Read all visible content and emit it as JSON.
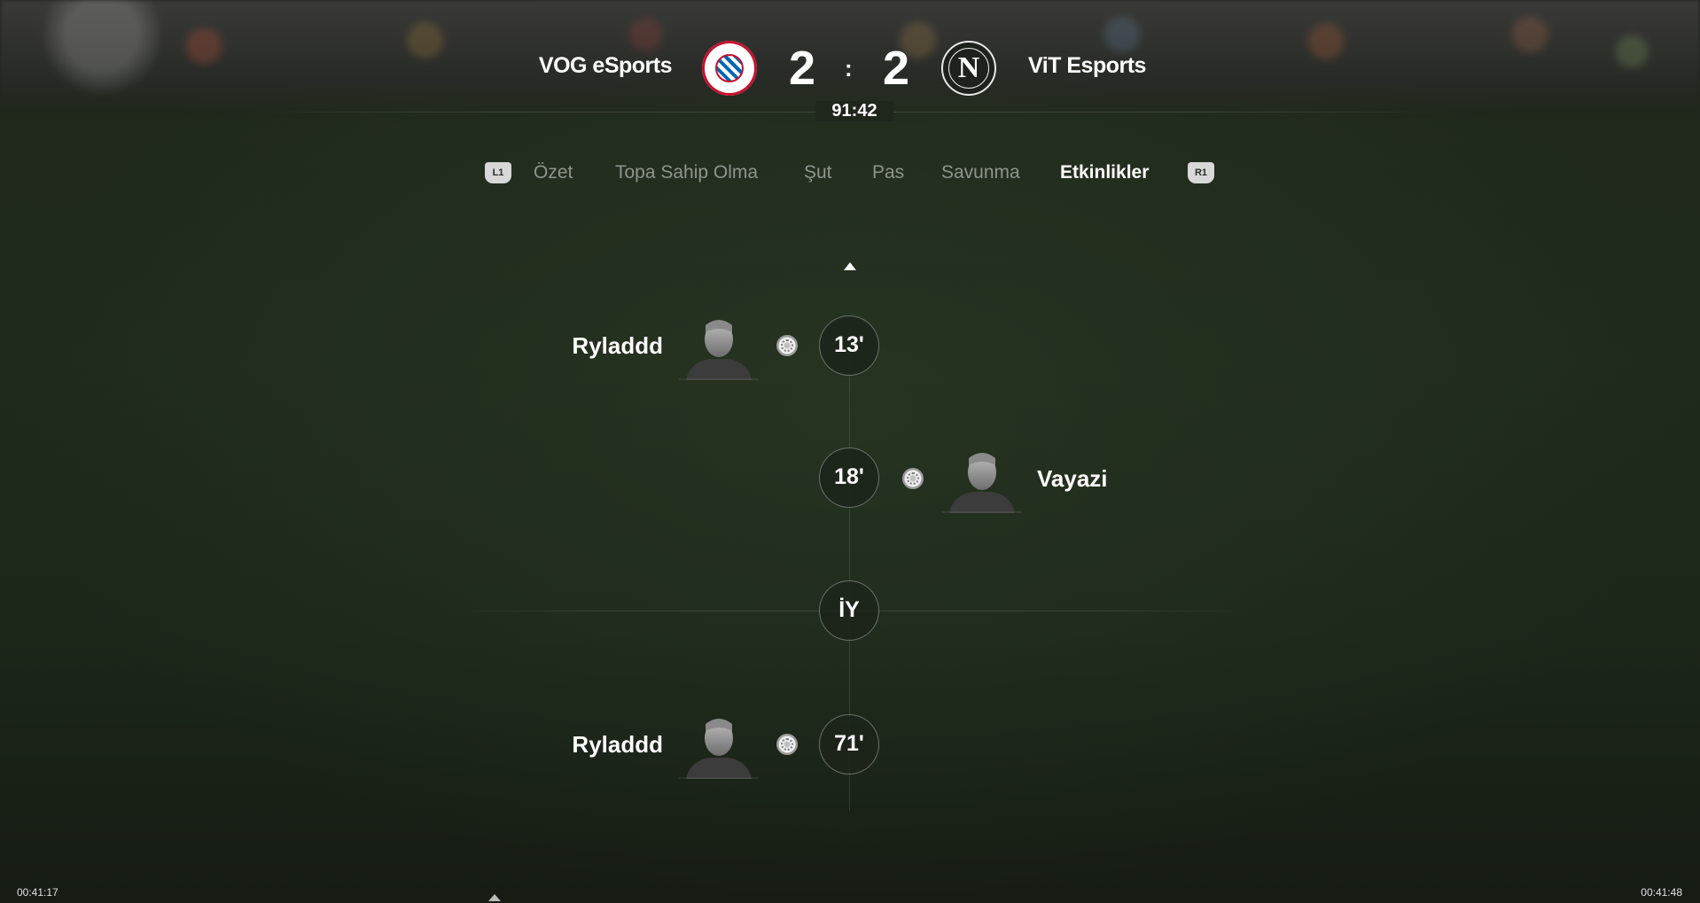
{
  "header": {
    "home_team": "VOG eSports",
    "away_team": "ViT Esports",
    "home_score": "2",
    "away_score": "2",
    "separator": ":",
    "clock": "91:42",
    "home_crest_icon": "bayern-munchen-crest-icon",
    "away_crest_icon": "napoli-crest-icon",
    "away_crest_letter": "N"
  },
  "tabs": {
    "left_badge": "L1",
    "right_badge": "R1",
    "items": [
      "Özet",
      "Topa Sahip Olma",
      "Şut",
      "Pas",
      "Savunma",
      "Etkinlikler"
    ],
    "active": "Etkinlikler"
  },
  "events": [
    {
      "minute": "13'",
      "side": "home",
      "player": "Ryladdd",
      "type": "goal"
    },
    {
      "minute": "18'",
      "side": "away",
      "player": "Vayazi",
      "type": "goal"
    },
    {
      "minute": "İY",
      "side": "divider",
      "player": "",
      "type": "half-time"
    },
    {
      "minute": "71'",
      "side": "home",
      "player": "Ryladdd",
      "type": "goal"
    }
  ],
  "video": {
    "time_left": "00:41:17",
    "time_right": "00:41:48"
  },
  "colors": {
    "active_tab": "#ffffff",
    "inactive_tab": "#8f948c",
    "home_crest_red": "#c8102e",
    "home_crest_blue": "#0066b2"
  }
}
